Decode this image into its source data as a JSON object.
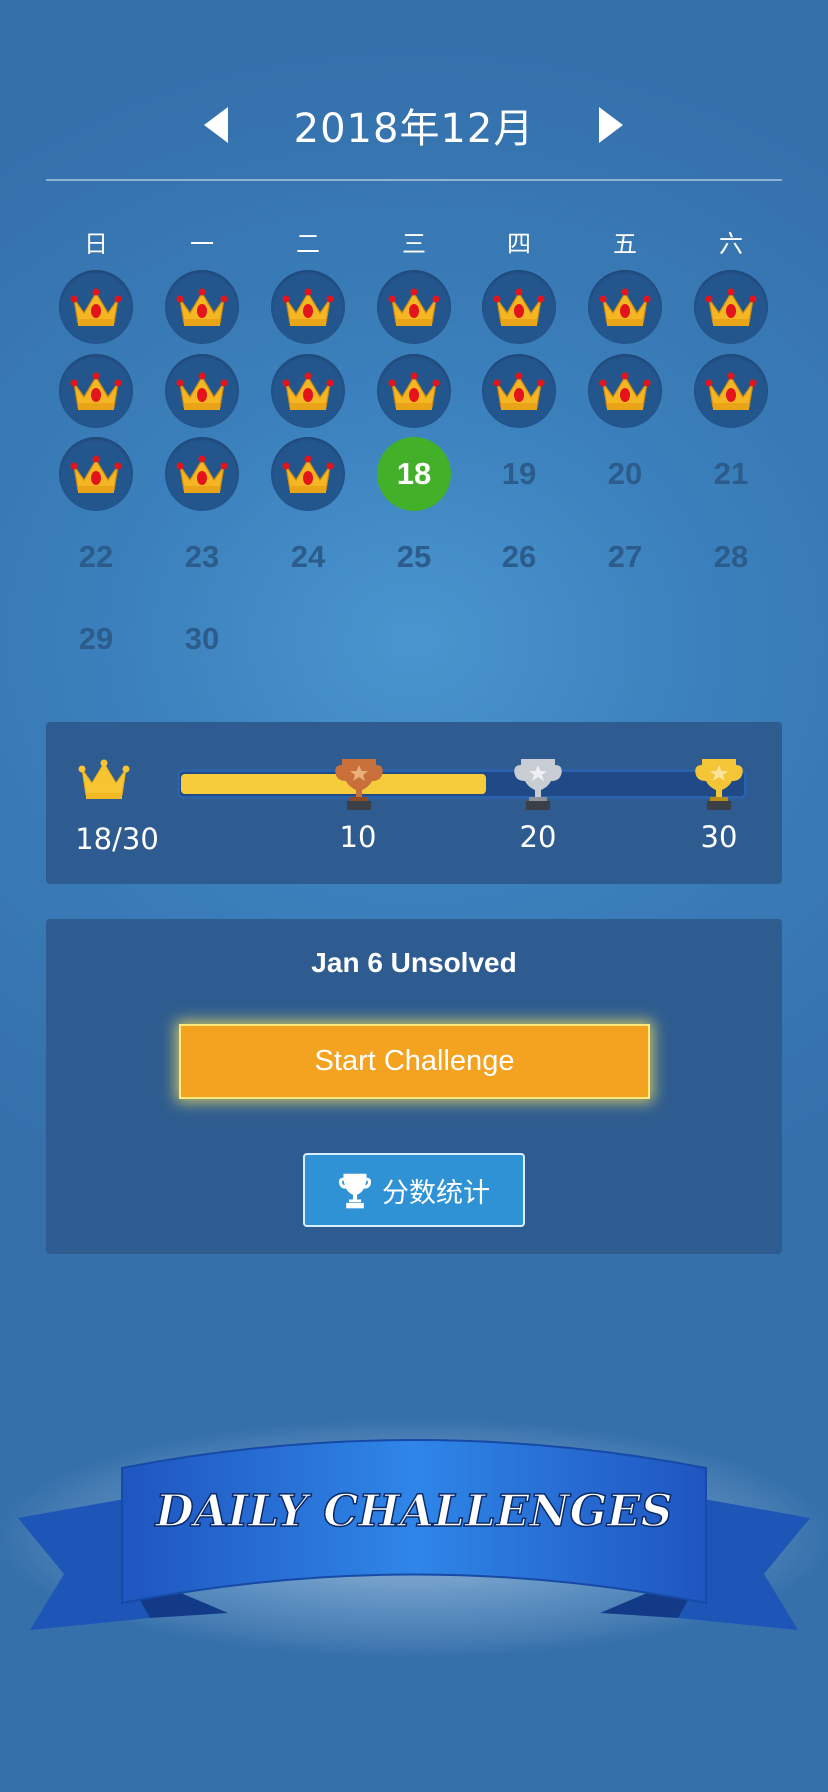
{
  "header": {
    "month_title": "2018年12月",
    "prev_icon": "left-triangle-icon",
    "next_icon": "right-triangle-icon"
  },
  "calendar": {
    "weekdays": [
      "日",
      "一",
      "二",
      "三",
      "四",
      "五",
      "六"
    ],
    "completed_days": [
      1,
      2,
      3,
      4,
      5,
      6,
      7,
      8,
      9,
      10,
      11,
      12,
      13,
      14,
      15,
      16,
      17
    ],
    "today": "18",
    "remaining_days": [
      "19",
      "20",
      "21",
      "22",
      "23",
      "24",
      "25",
      "26",
      "27",
      "28",
      "29",
      "30"
    ],
    "completed_icon": "crown-icon"
  },
  "progress": {
    "crowns_label": "18/30",
    "crowns_earned": 18,
    "crowns_total": 30,
    "milestones": [
      {
        "label": "10",
        "value": 10,
        "trophy": "bronze-trophy-icon",
        "color": "#c9703a"
      },
      {
        "label": "20",
        "value": 20,
        "trophy": "silver-trophy-icon",
        "color": "#c8ccd3"
      },
      {
        "label": "30",
        "value": 30,
        "trophy": "gold-trophy-icon",
        "color": "#f3c537"
      }
    ]
  },
  "challenge": {
    "status_text": "Jan 6 Unsolved",
    "start_label": "Start Challenge",
    "stats_label": "分数统计",
    "stats_icon": "trophy-icon"
  },
  "banner": {
    "text": "DAILY CHALLENGES"
  },
  "colors": {
    "background": "#3a7fbb",
    "panel": "#2e5c90",
    "today": "#43b02a",
    "start_button": "#f4a321",
    "stats_button": "#2f92d4",
    "progress_fill": "#f7cc3c"
  }
}
